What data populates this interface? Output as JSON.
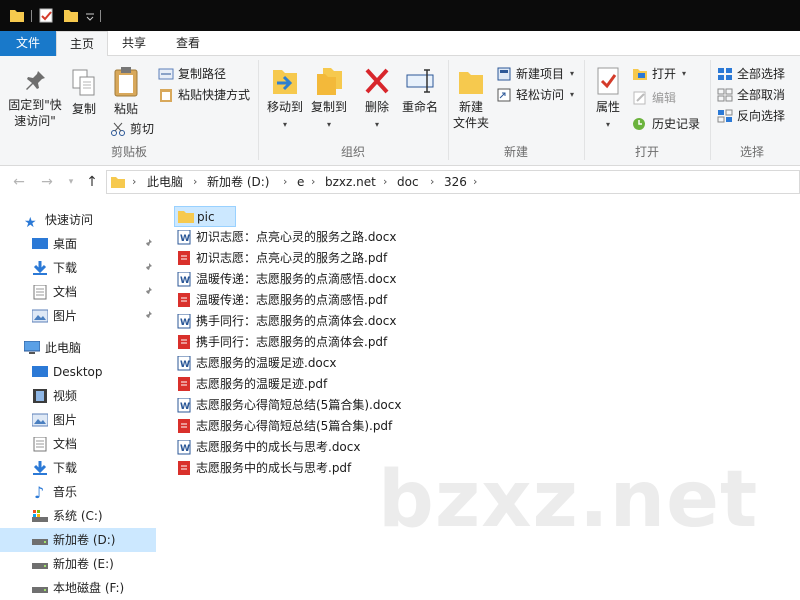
{
  "ribbon_tabs": {
    "file": "文件",
    "home": "主页",
    "share": "共享",
    "view": "查看"
  },
  "clipboard": {
    "pin_quick_access": "固定到\"快",
    "pin_quick_access_2": "速访问\"",
    "copy": "复制",
    "paste": "粘贴",
    "copy_path": "复制路径",
    "paste_shortcut": "粘贴快捷方式",
    "cut": "剪切",
    "label": "剪贴板"
  },
  "organize": {
    "move_to": "移动到",
    "copy_to": "复制到",
    "delete": "删除",
    "rename": "重命名",
    "label": "组织"
  },
  "new_group": {
    "new_folder": "新建",
    "new_folder_2": "文件夹",
    "new_item": "新建项目",
    "easy_access": "轻松访问",
    "label": "新建"
  },
  "open_group": {
    "properties": "属性",
    "open": "打开",
    "edit": "编辑",
    "history": "历史记录",
    "label": "打开"
  },
  "select_group": {
    "select_all": "全部选择",
    "select_none": "全部取消",
    "invert": "反向选择",
    "label": "选择"
  },
  "breadcrumb": [
    "此电脑",
    "新加卷 (D:)",
    "e",
    "bzxz.net",
    "doc",
    "326"
  ],
  "nav": {
    "quick_access": "快速访问",
    "qa_items": [
      "桌面",
      "下载",
      "文档",
      "图片"
    ],
    "this_pc": "此电脑",
    "pc_items": [
      "Desktop",
      "视频",
      "图片",
      "文档",
      "下载",
      "音乐",
      "系统 (C:)",
      "新加卷 (D:)",
      "新加卷 (E:)",
      "本地磁盘 (F:)"
    ]
  },
  "files": [
    {
      "name": "pic",
      "type": "folder"
    },
    {
      "name": "初识志愿：点亮心灵的服务之路.docx",
      "type": "docx"
    },
    {
      "name": "初识志愿：点亮心灵的服务之路.pdf",
      "type": "pdf"
    },
    {
      "name": "温暖传递：志愿服务的点滴感悟.docx",
      "type": "docx"
    },
    {
      "name": "温暖传递：志愿服务的点滴感悟.pdf",
      "type": "pdf"
    },
    {
      "name": "携手同行：志愿服务的点滴体会.docx",
      "type": "docx"
    },
    {
      "name": "携手同行：志愿服务的点滴体会.pdf",
      "type": "pdf"
    },
    {
      "name": "志愿服务的温暖足迹.docx",
      "type": "docx"
    },
    {
      "name": "志愿服务的温暖足迹.pdf",
      "type": "pdf"
    },
    {
      "name": "志愿服务心得简短总结(5篇合集).docx",
      "type": "docx"
    },
    {
      "name": "志愿服务心得简短总结(5篇合集).pdf",
      "type": "pdf"
    },
    {
      "name": "志愿服务中的成长与思考.docx",
      "type": "docx"
    },
    {
      "name": "志愿服务中的成长与思考.pdf",
      "type": "pdf"
    }
  ],
  "watermark": "bzxz.net",
  "colors": {
    "accent": "#1979ca",
    "selection": "#cce8ff",
    "folder": "#f6c94e",
    "pdf": "#d9302b",
    "word": "#2b5797"
  }
}
